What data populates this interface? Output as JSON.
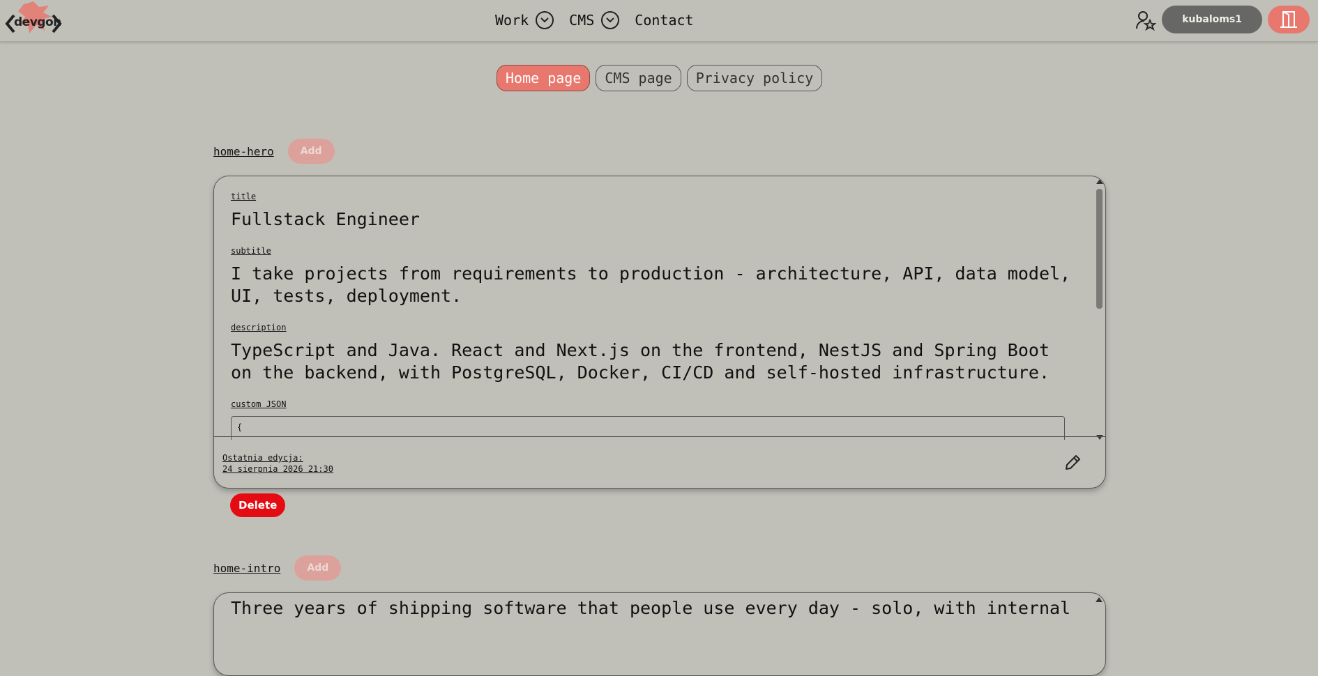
{
  "header": {
    "logo_text": "devgon",
    "nav": [
      {
        "label": "Work",
        "has_dropdown": true
      },
      {
        "label": "CMS",
        "has_dropdown": true
      },
      {
        "label": "Contact",
        "has_dropdown": false
      }
    ],
    "user_icon": "user-star-icon",
    "username": "kubaloms1",
    "logout_icon": "door-exit-icon"
  },
  "tabs": [
    {
      "label": "Home page",
      "active": true
    },
    {
      "label": "CMS page",
      "active": false
    },
    {
      "label": "Privacy policy",
      "active": false
    }
  ],
  "sections": [
    {
      "key": "home-hero",
      "add_label": "Add",
      "fields": {
        "title_label": "title",
        "title": "Fullstack Engineer",
        "subtitle_label": "subtitle",
        "subtitle": "I take projects from requirements to production - architecture, API, data model, UI, tests, deployment.",
        "description_label": "description",
        "description": "TypeScript and Java. React and Next.js on the frontend, NestJS and Spring Boot on the backend, with PostgreSQL, Docker, CI/CD and self-hosted infrastructure.",
        "json_label": "custom JSON",
        "json_value": "{"
      },
      "last_edit_label": "Ostatnia edycja:",
      "last_edit_date": "24 sierpnia 2026 21:30",
      "delete_label": "Delete"
    },
    {
      "key": "home-intro",
      "add_label": "Add",
      "preview": "Three years of shipping software that people use every day - solo, with internal"
    }
  ],
  "colors": {
    "background": "#c0c0b8",
    "accent": "#e8786e",
    "delete": "#e40c12",
    "user_button": "#676765"
  }
}
